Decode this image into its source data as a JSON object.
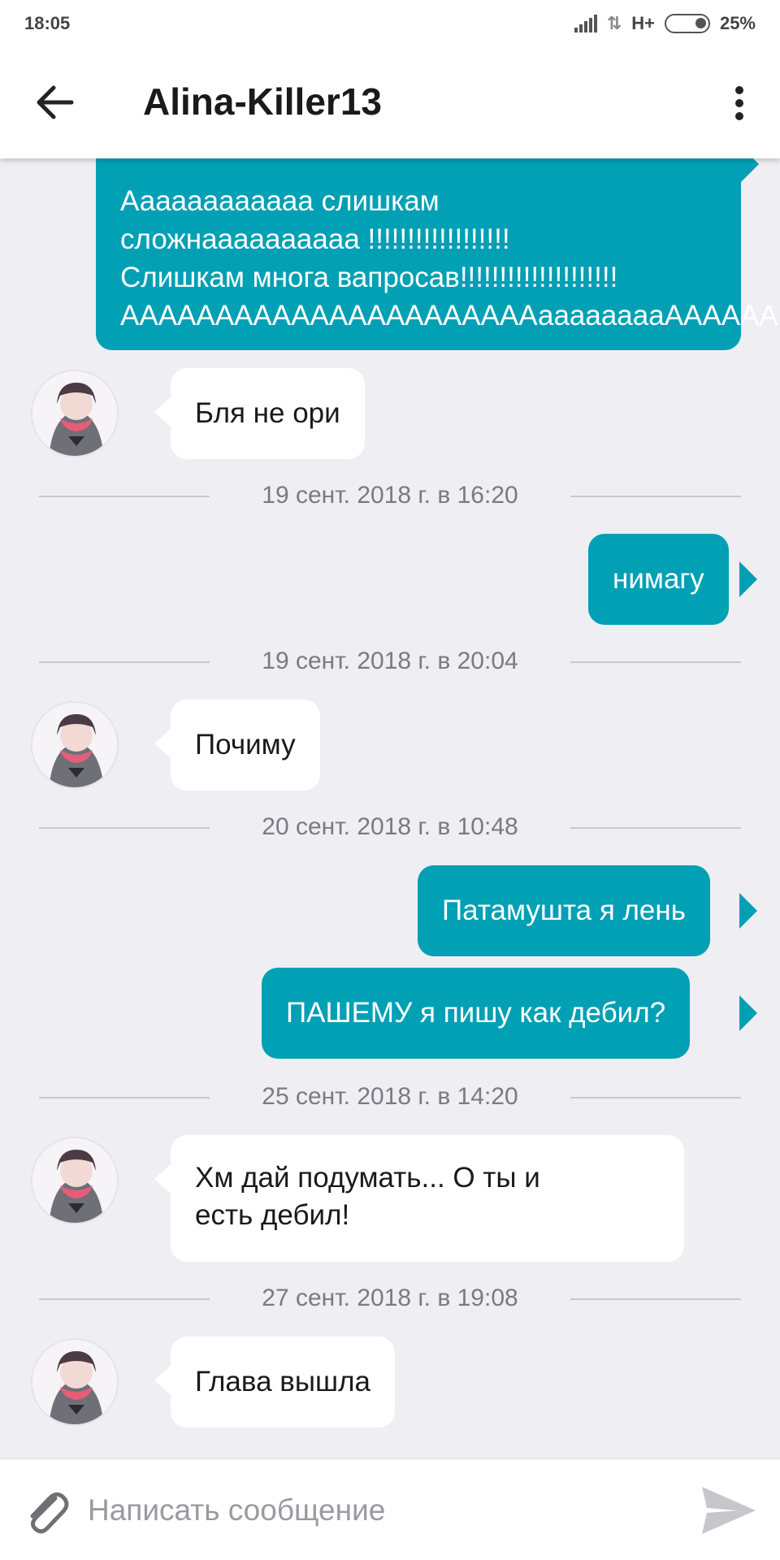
{
  "status_bar": {
    "time": "18:05",
    "network": "H+",
    "battery": "25%"
  },
  "toolbar": {
    "title": "Alina-Killer13"
  },
  "messages": [
    {
      "type": "out",
      "text": "Аааааааааааа слишкам\nсложнаааааааааа !!!!!!!!!!!!!!!!!!\nСлишкам многа вапросав!!!!!!!!!!!!!!!!!!!!\nААААААААААААААААААААААааааааааААААААааа"
    },
    {
      "type": "in",
      "text": "Бля не ори"
    },
    {
      "type": "date",
      "text": "19 сент. 2018 г. в 16:20"
    },
    {
      "type": "out",
      "text": "нимагу"
    },
    {
      "type": "date",
      "text": "19 сент. 2018 г. в 20:04"
    },
    {
      "type": "in",
      "text": "Почиму"
    },
    {
      "type": "date",
      "text": "20 сент. 2018 г. в 10:48"
    },
    {
      "type": "out",
      "text": "Патамушта я лень"
    },
    {
      "type": "out",
      "text": "ПАШЕМУ я пишу как дебил?"
    },
    {
      "type": "date",
      "text": "25 сент. 2018 г. в 14:20"
    },
    {
      "type": "in",
      "text": "Хм дай подумать... О ты и\nесть дебил!"
    },
    {
      "type": "date",
      "text": "27 сент. 2018 г. в 19:08"
    },
    {
      "type": "in",
      "text": "Глава вышла"
    }
  ],
  "composer": {
    "placeholder": "Написать сообщение"
  },
  "colors": {
    "outgoing_bubble": "#01a0b5",
    "incoming_bubble": "#ffffff",
    "background": "#efeef2"
  },
  "icons": [
    "back-arrow-icon",
    "more-vert-icon",
    "attach-icon",
    "send-icon",
    "signal-icon",
    "battery-icon"
  ]
}
